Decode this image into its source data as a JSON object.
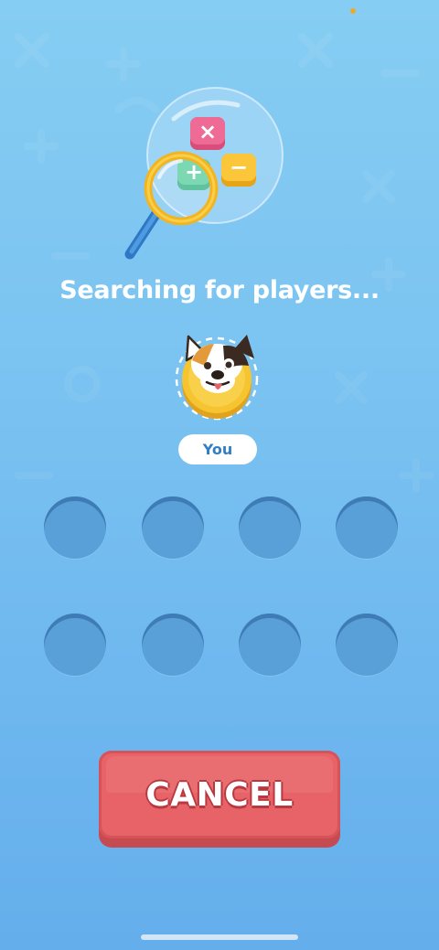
{
  "screen": {
    "title": "Searching for players...",
    "player_label": "You",
    "empty_slot_count": 8,
    "cancel_label": "CANCEL"
  },
  "hero": {
    "icons": [
      "multiply-icon",
      "plus-icon",
      "minus-icon",
      "magnifier-icon"
    ],
    "symbols": {
      "multiply": "×",
      "plus": "+",
      "minus": "−"
    }
  },
  "player": {
    "avatar": "dog-avatar-icon"
  },
  "colors": {
    "background_top": "#86cdf3",
    "background_bottom": "#64aeec",
    "button_face": "#e86368",
    "button_shadow": "#c64b51",
    "you_text": "#2f7fc7",
    "avatar_yellow": "#f5c430"
  }
}
